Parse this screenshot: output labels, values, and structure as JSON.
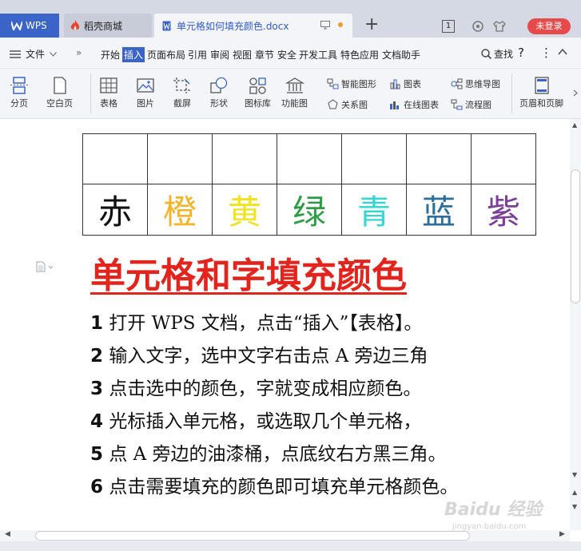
{
  "titlebar": {
    "tab_wps": "WPS",
    "tab_store": "稻壳商城",
    "tab_doc": "单元格如何填充颜色.docx",
    "new_tab": "+",
    "badge": "1",
    "login": "未登录"
  },
  "menubar": {
    "file": "文件",
    "more": "»",
    "tabs": [
      "开始",
      "插入",
      "页面布局",
      "引用",
      "审阅",
      "视图",
      "章节",
      "安全",
      "开发工具",
      "特色应用",
      "文档助手"
    ],
    "active_tab": "插入",
    "search": "查找",
    "help": "?",
    "more_menu": "⋮",
    "collapse": "^"
  },
  "ribbon": {
    "page_break": "分页",
    "blank_page": "空白页",
    "table": "表格",
    "picture": "图片",
    "screenshot": "截屏",
    "shape": "形状",
    "icon_lib": "图标库",
    "func_chart": "功能图",
    "smart_graphic": "智能图形",
    "chart": "图表",
    "mind_map": "思维导图",
    "relation_chart": "关系图",
    "online_chart": "在线图表",
    "flowchart": "流程图",
    "header_footer": "页眉和页脚"
  },
  "document": {
    "color_chars": [
      {
        "char": "赤",
        "color": "#111111"
      },
      {
        "char": "橙",
        "color": "#f2b52a"
      },
      {
        "char": "黄",
        "color": "#f3e21c"
      },
      {
        "char": "绿",
        "color": "#2e9e46"
      },
      {
        "char": "青",
        "color": "#35d6d4"
      },
      {
        "char": "蓝",
        "color": "#2a6f9e"
      },
      {
        "char": "紫",
        "color": "#7b3f99"
      }
    ],
    "heading": "单元格和字填充颜色",
    "steps": [
      {
        "num": "1",
        "text": " 打开 WPS 文档，点击“插入”【表格】。"
      },
      {
        "num": "2",
        "text": " 输入文字，选中文字右击点 A 旁边三角"
      },
      {
        "num": "3",
        "text": " 点击选中的颜色，字就变成相应颜色。"
      },
      {
        "num": "4",
        "text": " 光标插入单元格，或选取几个单元格，"
      },
      {
        "num": "5",
        "text": " 点 A 旁边的油漆桶，点底纹右方黑三角。"
      },
      {
        "num": "6",
        "text": " 点击需要填充的颜色即可填充单元格颜色。"
      }
    ]
  },
  "watermark": {
    "main": "Baidu 经验",
    "sub": "jingyan.baidu.com"
  },
  "colors": {
    "accent": "#3a64c7",
    "heading_red": "#e3241d",
    "login_red": "#e64a4a"
  }
}
